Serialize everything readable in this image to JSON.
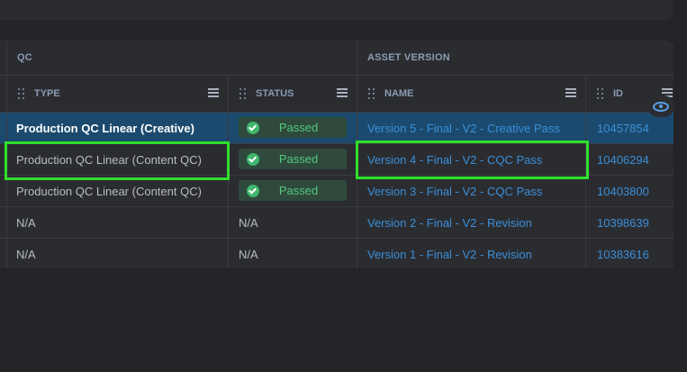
{
  "groups": {
    "qc": "QC",
    "asset_version": "ASSET VERSION"
  },
  "columns": {
    "type": "TYPE",
    "status": "STATUS",
    "name": "NAME",
    "id": "ID"
  },
  "rows": [
    {
      "type": "Production QC Linear (Creative)",
      "status": "Passed",
      "name": "Version 5 - Final - V2 - Creative Pass",
      "id": "10457854"
    },
    {
      "type": "Production QC Linear (Content QC)",
      "status": "Passed",
      "name": "Version 4 - Final - V2 - CQC Pass",
      "id": "10406294"
    },
    {
      "type": "Production QC Linear (Content QC)",
      "status": "Passed",
      "name": "Version 3 - Final - V2 - CQC Pass",
      "id": "10403800"
    },
    {
      "type": "N/A",
      "status": "N/A",
      "name": "Version 2 - Final - V2 - Revision",
      "id": "10398639"
    },
    {
      "type": "N/A",
      "status": "N/A",
      "name": "Version 1 - Final - V2 - Revision",
      "id": "10383616"
    }
  ],
  "colors": {
    "accent_link": "#3b8fd9",
    "selected_row": "#1b4a6e",
    "passed": "#52c77b",
    "highlight": "#2ee02b"
  },
  "icons": {
    "drag_handle": "drag-handle-icon",
    "column_menu": "hamburger-menu-icon",
    "status_passed": "check-circle-icon",
    "view": "eye-icon"
  }
}
